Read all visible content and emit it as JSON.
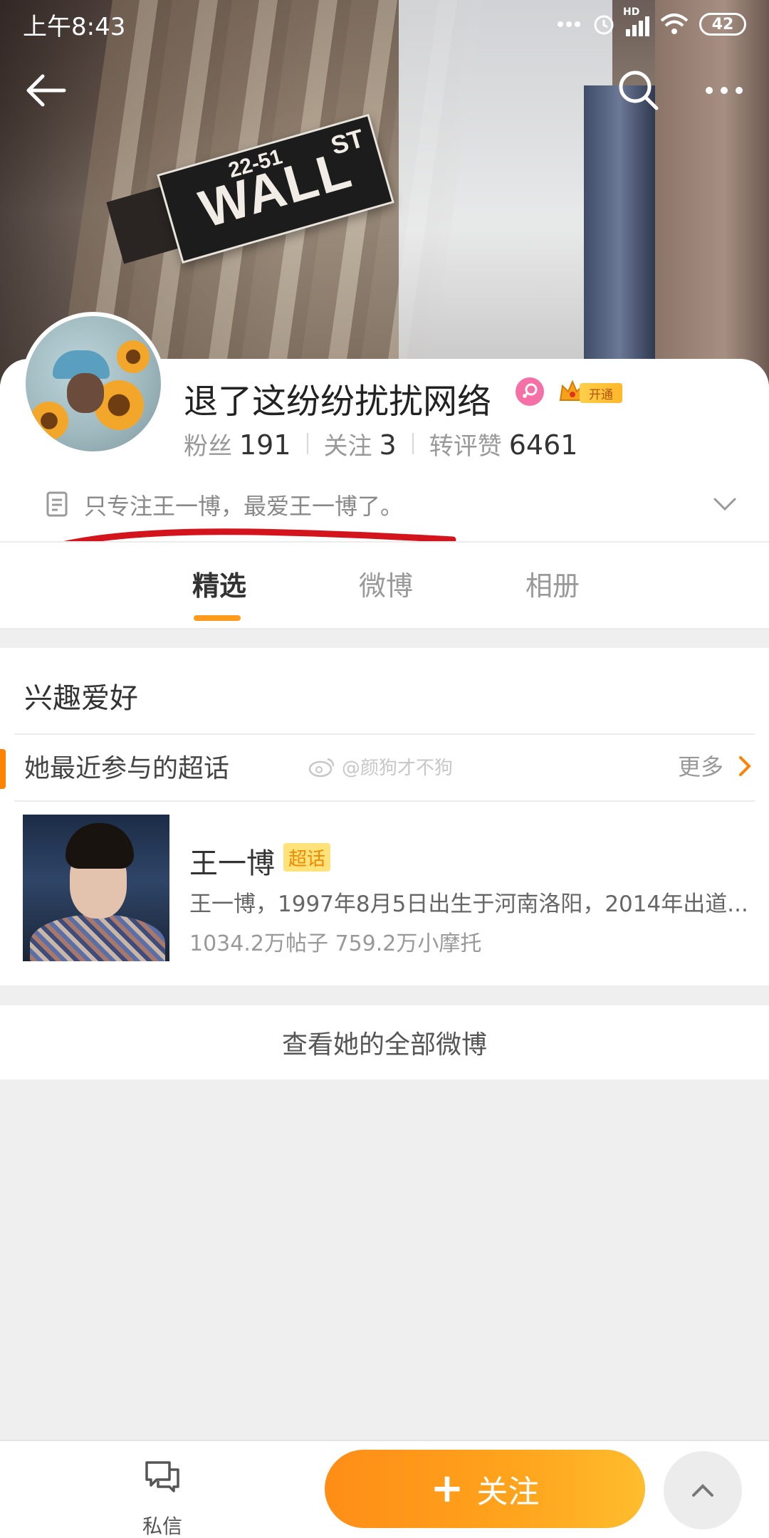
{
  "status_bar": {
    "time": "上午8:43",
    "signal_label": "HD",
    "battery": "42"
  },
  "header": {
    "cover_sign": {
      "street": "WALL",
      "address": "22-51",
      "suffix": "ST"
    }
  },
  "profile": {
    "name": "退了这纷纷扰扰网络",
    "gender": "female",
    "vip_label": "开通",
    "stats": [
      {
        "label": "粉丝",
        "value": "191"
      },
      {
        "label": "关注",
        "value": "3"
      },
      {
        "label": "转评赞",
        "value": "6461"
      }
    ],
    "bio": "只专注王一博，最爱王一博了。",
    "annotation_color": "#d4141c"
  },
  "tabs": [
    {
      "label": "精选",
      "active": true
    },
    {
      "label": "微博",
      "active": false
    },
    {
      "label": "相册",
      "active": false
    }
  ],
  "interests": {
    "title": "兴趣爱好",
    "subsection_title": "她最近参与的超话",
    "watermark": "@颜狗才不狗",
    "more_label": "更多",
    "topic": {
      "name": "王一博",
      "badge": "超话",
      "description": "王一博，1997年8月5日出生于河南洛阳，2014年出道...",
      "stats": "1034.2万帖子  759.2万小摩托"
    }
  },
  "view_all_label": "查看她的全部微博",
  "bottom_bar": {
    "dm_label": "私信",
    "follow_label": "关注",
    "accent_color": "#ff8d17"
  },
  "icons": [
    "back-arrow-icon",
    "search-icon",
    "more-icon",
    "bio-document-icon",
    "chevron-down-icon",
    "chevron-right-icon",
    "message-icon",
    "plus-icon",
    "chevron-up-icon",
    "alarm-icon",
    "wifi-icon",
    "signal-icon"
  ]
}
